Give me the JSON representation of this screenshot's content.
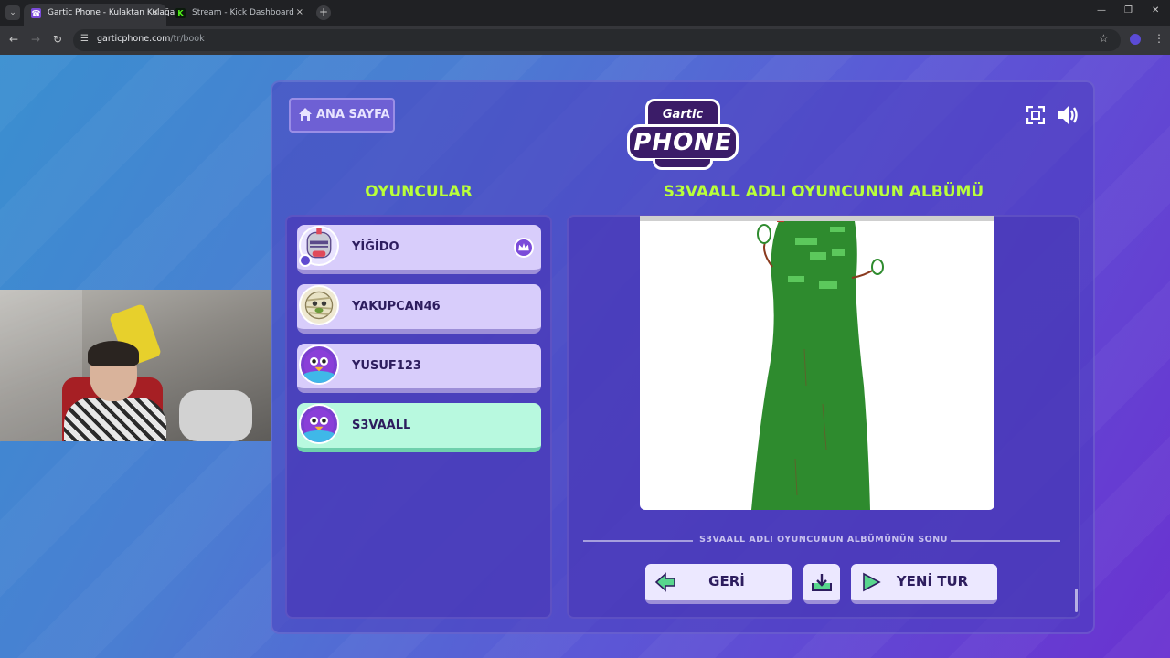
{
  "browser": {
    "tabs": [
      {
        "title": "Gartic Phone - Kulaktan Kulağa",
        "favicon_color": "#7b4bd9",
        "active": true
      },
      {
        "title": "Stream - Kick Dashboard",
        "favicon_color": "#53fc18",
        "active": false
      }
    ],
    "url_domain": "garticphone.com",
    "url_path": "/tr/book",
    "icons": {
      "tab_search": "chevron-down-icon",
      "new_tab": "plus-icon",
      "back": "arrow-left-icon",
      "forward": "arrow-right-icon",
      "reload": "reload-icon",
      "site_info": "site-settings-icon",
      "bookmark": "star-icon",
      "menu": "more-vertical-icon"
    },
    "symbols": {
      "tab_search": "⌄",
      "close": "×",
      "new_tab": "+",
      "back": "←",
      "forward": "→",
      "reload": "↻",
      "site_info": "☰",
      "star": "☆",
      "menu": "⋮",
      "minimize": "—",
      "maximize": "❐",
      "window_close": "✕",
      "kick_favicon": "K",
      "gartic_favicon": "☎"
    }
  },
  "game": {
    "home_button_label": "ANA SAYFA",
    "logo_top": "Gartic",
    "logo_main": "PHONE",
    "players_title": "OYUNCULAR",
    "album_title": "S3VAALL ADLI OYUNCUNUN ALBÜMÜ",
    "players": [
      {
        "name": "YİĞİDO",
        "avatar": "knight-avatar",
        "is_host": true,
        "highlighted": false
      },
      {
        "name": "YAKUPCAN46",
        "avatar": "mummy-avatar",
        "is_host": false,
        "highlighted": false
      },
      {
        "name": "YUSUF123",
        "avatar": "bird-avatar",
        "is_host": false,
        "highlighted": false
      },
      {
        "name": "S3VAALL",
        "avatar": "bird-avatar",
        "is_host": false,
        "highlighted": true
      }
    ],
    "album_end_text": "S3VAALL ADLI OYUNCUNUN ALBÜMÜNÜN SONU",
    "back_label": "GERİ",
    "new_round_label": "YENİ TUR",
    "colors": {
      "accent_title": "#b9ff3a",
      "card": "#d8cdfb",
      "card_highlight": "#b8f9df",
      "drawing_green": "#2e8b2e"
    }
  }
}
